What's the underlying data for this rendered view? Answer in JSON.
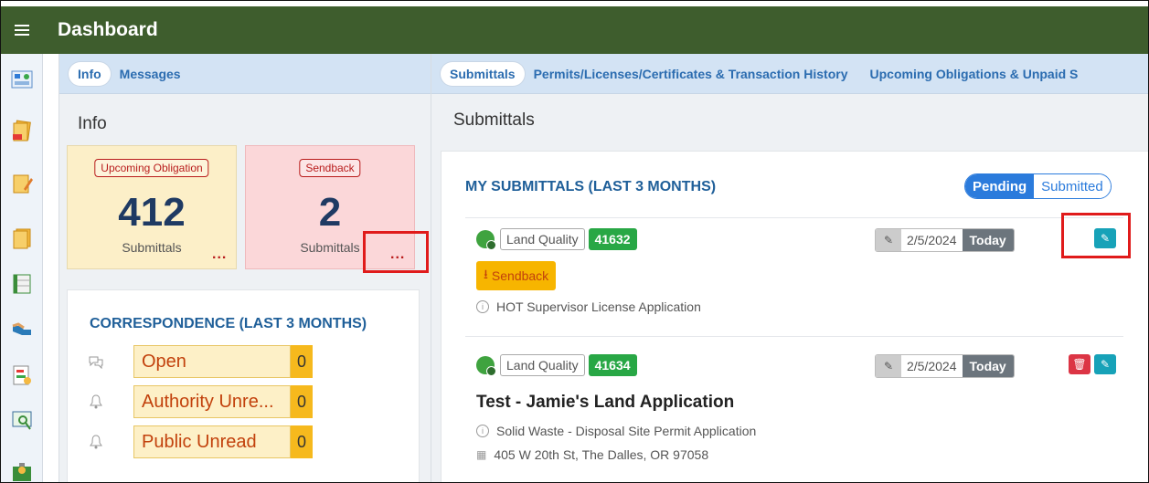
{
  "header": {
    "title": "Dashboard"
  },
  "left_tabs": [
    {
      "label": "Info",
      "active": true
    },
    {
      "label": "Messages",
      "active": false
    }
  ],
  "left": {
    "title": "Info",
    "cards": [
      {
        "badge": "Upcoming Obligation",
        "count": "412",
        "sub": "Submittals",
        "more": "..."
      },
      {
        "badge": "Sendback",
        "count": "2",
        "sub": "Submittals",
        "more": "..."
      }
    ],
    "correspondence": {
      "title": "CORRESPONDENCE (LAST 3 MONTHS)",
      "rows": [
        {
          "icon": "chat-icon",
          "label": "Open",
          "count": "0"
        },
        {
          "icon": "bell-icon",
          "label": "Authority Unre...",
          "count": "0"
        },
        {
          "icon": "bell-icon",
          "label": "Public Unread",
          "count": "0"
        }
      ]
    }
  },
  "right_tabs": [
    {
      "label": "Submittals",
      "active": true
    },
    {
      "label": "Permits/Licenses/Certificates & Transaction History",
      "active": false
    },
    {
      "label": "Upcoming Obligations & Unpaid S",
      "active": false
    }
  ],
  "right": {
    "title": "Submittals",
    "list_title": "MY SUBMITTALS (LAST 3 MONTHS)",
    "toggle": {
      "on": "Pending",
      "off": "Submitted"
    },
    "items": [
      {
        "program": "Land Quality",
        "id": "41632",
        "date": "2/5/2024",
        "today": "Today",
        "status": "Sendback",
        "description": "HOT Supervisor License Application"
      },
      {
        "program": "Land Quality",
        "id": "41634",
        "date": "2/5/2024",
        "today": "Today",
        "title": "Test - Jamie's Land Application",
        "description": "Solid Waste - Disposal Site Permit Application",
        "address": "405 W 20th St, The Dalles, OR 97058"
      }
    ]
  },
  "colors": {
    "header": "#3e5d2d",
    "accent": "#2b7bdc",
    "highlight": "#e01b1b"
  }
}
